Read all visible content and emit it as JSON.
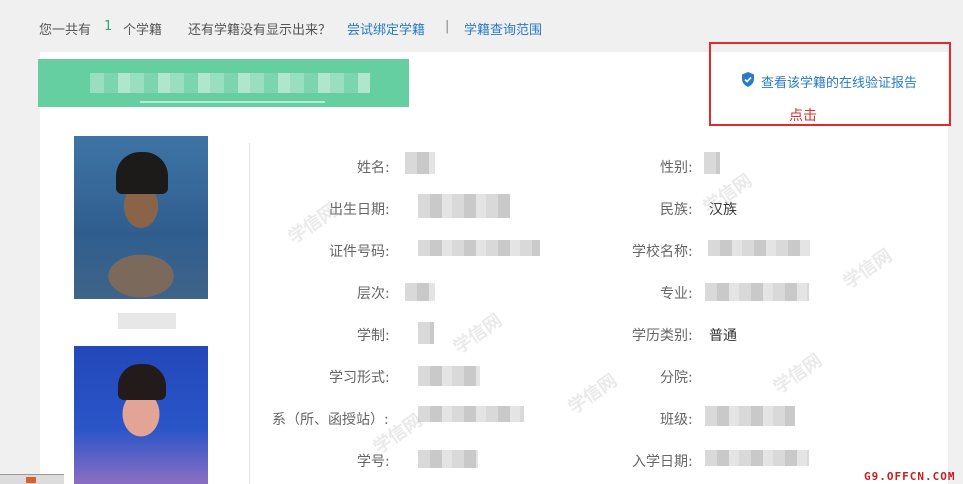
{
  "topbar": {
    "total_prefix": "您一共有",
    "total_count": "1",
    "total_suffix": "个学籍",
    "missing_question": "还有学籍没有显示出来？",
    "bind_link": "尝试绑定学籍",
    "separator": "|",
    "scope_link": "学籍查询范围"
  },
  "verify": {
    "link_label": "查看该学籍的在线验证报告",
    "icon": "shield-check-icon",
    "note": "点击",
    "note_color": "#e32b2b"
  },
  "profile": {
    "left_fields": [
      {
        "label": "姓名:",
        "value": ""
      },
      {
        "label": "出生日期:",
        "value": ""
      },
      {
        "label": "证件号码:",
        "value": ""
      },
      {
        "label": "层次:",
        "value": ""
      },
      {
        "label": "学制:",
        "value": ""
      },
      {
        "label": "学习形式:",
        "value": ""
      },
      {
        "label": "系（所、函授站）:",
        "value": ""
      },
      {
        "label": "学号:",
        "value": ""
      }
    ],
    "right_fields": [
      {
        "label": "性别:",
        "value": ""
      },
      {
        "label": "民族:",
        "value": "汉族"
      },
      {
        "label": "学校名称:",
        "value": ""
      },
      {
        "label": "专业:",
        "value": ""
      },
      {
        "label": "学历类别:",
        "value": "普通"
      },
      {
        "label": "分院:",
        "value": ""
      },
      {
        "label": "班级:",
        "value": ""
      },
      {
        "label": "入学日期:",
        "value": ""
      }
    ]
  },
  "watermark_text": "学信网",
  "site_tag": "G9.OFFCN.COM",
  "colors": {
    "accent_green": "#66cfa1",
    "link_blue": "#2a7bc4",
    "highlight_red": "#e32b2b"
  }
}
